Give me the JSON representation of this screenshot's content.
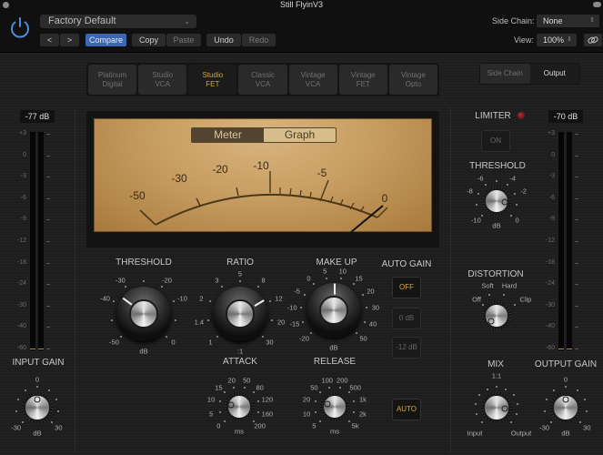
{
  "window": {
    "title": "Still FlyinV3"
  },
  "header": {
    "preset": "Factory Default",
    "nav_prev": "<",
    "nav_next": ">",
    "compare": "Compare",
    "copy": "Copy",
    "paste": "Paste",
    "undo": "Undo",
    "redo": "Redo",
    "side_chain_label": "Side Chain:",
    "side_chain_value": "None",
    "view_label": "View:",
    "view_value": "100%",
    "icons": {
      "power": "power-icon",
      "link": "link-icon",
      "preset_chevron": "chevron-down-icon",
      "stepper": "up-down-icon"
    }
  },
  "models": [
    {
      "label": "Platinum\nDigital",
      "active": false
    },
    {
      "label": "Studio\nVCA",
      "active": false
    },
    {
      "label": "Studio\nFET",
      "active": true
    },
    {
      "label": "Classic\nVCA",
      "active": false
    },
    {
      "label": "Vintage\nVCA",
      "active": false
    },
    {
      "label": "Vintage\nFET",
      "active": false
    },
    {
      "label": "Vintage\nOpto",
      "active": false
    }
  ],
  "output_tabs": {
    "side_chain": "Side Chain",
    "output": "Output",
    "selected": "Output"
  },
  "colors": {
    "accent_gold": "#d5a838",
    "compare_blue": "#3b68b0",
    "vu_face": "#c79e62"
  },
  "input_meter": {
    "reading": "-77 dB",
    "scale": [
      "+3",
      "0",
      "-3",
      "-6",
      "-9",
      "-12",
      "-18",
      "-24",
      "-30",
      "-40",
      "-60"
    ]
  },
  "output_meter": {
    "reading": "-70 dB",
    "scale": [
      "+3",
      "0",
      "-3",
      "-6",
      "-9",
      "-12",
      "-18",
      "-24",
      "-30",
      "-40",
      "-60"
    ]
  },
  "vu": {
    "toggle": {
      "meter": "Meter",
      "graph": "Graph",
      "selected": "Meter"
    },
    "scale_labels": [
      "-50",
      "-30",
      "-20",
      "-10",
      "-5",
      "0"
    ],
    "needle_value_db": 0
  },
  "knobs": {
    "threshold": {
      "label": "THRESHOLD",
      "unit": "dB",
      "ticks": [
        "-50",
        "-40",
        "-30",
        "-20",
        "-10",
        "0"
      ],
      "value_fraction": 0.3
    },
    "ratio": {
      "label": "RATIO",
      "unit": ":1",
      "ticks": [
        "1",
        "1.4",
        "2",
        "3",
        "5",
        "8",
        "12",
        "20",
        "30"
      ],
      "value_fraction": 0.72
    },
    "makeup": {
      "label": "MAKE UP",
      "unit": "dB",
      "ticks": [
        "-20",
        "-15",
        "-10",
        "-5",
        "0",
        "5",
        "10",
        "15",
        "20",
        "30",
        "40",
        "50"
      ],
      "value_fraction": 0.5
    },
    "attack": {
      "label": "ATTACK",
      "unit": "ms",
      "ticks": [
        "0",
        "5",
        "10",
        "15",
        "20",
        "50",
        "80",
        "120",
        "160",
        "200"
      ],
      "value_fraction": 0.22
    },
    "release": {
      "label": "RELEASE",
      "unit": "ms",
      "ticks": [
        "5",
        "10",
        "20",
        "50",
        "100",
        "200",
        "500",
        "1k",
        "2k",
        "5k"
      ],
      "value_fraction": 0.25
    },
    "input_gain": {
      "label": "INPUT GAIN",
      "unit": "dB",
      "ticks": [
        "-30",
        "0",
        "30"
      ],
      "value_fraction": 0.5
    },
    "limiter_threshold": {
      "label": "THRESHOLD",
      "unit": "dB",
      "ticks": [
        "-10",
        "-8",
        "-6",
        "-4",
        "-2",
        "0"
      ],
      "value_fraction": 0.85
    },
    "distortion": {
      "label": "DISTORTION",
      "ticks": [
        "Off",
        "Soft",
        "Hard",
        "Clip"
      ],
      "value_fraction": 0.0
    },
    "mix": {
      "label": "MIX",
      "ticks": [
        "Input",
        "1:1",
        "Output"
      ],
      "value_fraction": 0.85
    },
    "output_gain": {
      "label": "OUTPUT GAIN",
      "unit": "dB",
      "ticks": [
        "-30",
        "0",
        "30"
      ],
      "value_fraction": 0.5
    }
  },
  "auto_gain": {
    "label": "AUTO GAIN",
    "off": "OFF",
    "zero": "0 dB",
    "minus12": "-12 dB",
    "selected": "OFF"
  },
  "release_auto": "AUTO",
  "limiter": {
    "label": "LIMITER",
    "on_button": "ON",
    "led_state": "off"
  }
}
